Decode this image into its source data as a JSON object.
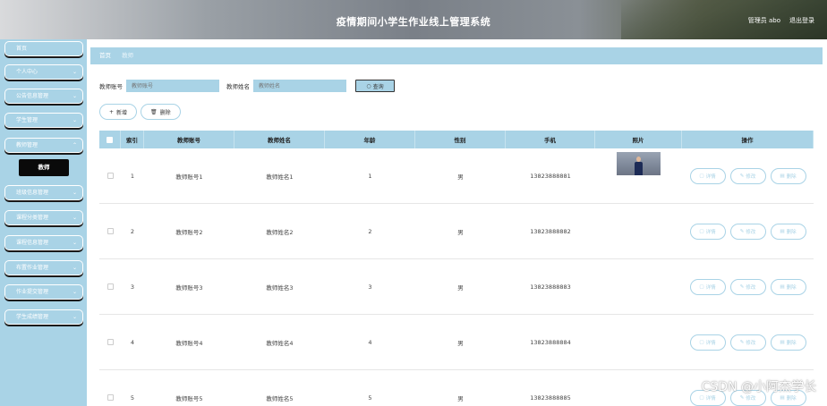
{
  "header": {
    "title": "疫情期间小学生作业线上管理系统",
    "user_label": "管理员 abo",
    "logout_label": "退出登录"
  },
  "sidebar": {
    "items": [
      {
        "label": "首页",
        "has_chevron": false
      },
      {
        "label": "个人中心",
        "has_chevron": true
      },
      {
        "label": "公告信息管理",
        "has_chevron": true
      },
      {
        "label": "学生管理",
        "has_chevron": true
      },
      {
        "label": "教师管理",
        "has_chevron": true
      },
      {
        "label": "班级信息管理",
        "has_chevron": true
      },
      {
        "label": "课程分类管理",
        "has_chevron": true
      },
      {
        "label": "课程信息管理",
        "has_chevron": true
      },
      {
        "label": "布置作业管理",
        "has_chevron": true
      },
      {
        "label": "作业提交管理",
        "has_chevron": true
      },
      {
        "label": "学生成绩管理",
        "has_chevron": true
      }
    ],
    "active_submenu": "教师"
  },
  "breadcrumb": {
    "home": "首页",
    "current": "教师"
  },
  "search": {
    "account_label": "教师账号",
    "account_placeholder": "教师账号",
    "name_label": "教师姓名",
    "name_placeholder": "教师姓名",
    "button_label": "查询"
  },
  "actions": {
    "add_label": "新增",
    "delete_label": "删除"
  },
  "table": {
    "headers": [
      "",
      "索引",
      "教师账号",
      "教师姓名",
      "年龄",
      "性别",
      "手机",
      "照片",
      "操作"
    ],
    "rows": [
      {
        "index": "1",
        "account": "教师账号1",
        "name": "教师姓名1",
        "age": "1",
        "gender": "男",
        "phone": "13823888881",
        "has_photo": true
      },
      {
        "index": "2",
        "account": "教师账号2",
        "name": "教师姓名2",
        "age": "2",
        "gender": "男",
        "phone": "13823888882",
        "has_photo": false
      },
      {
        "index": "3",
        "account": "教师账号3",
        "name": "教师姓名3",
        "age": "3",
        "gender": "男",
        "phone": "13823888883",
        "has_photo": false
      },
      {
        "index": "4",
        "account": "教师账号4",
        "name": "教师姓名4",
        "age": "4",
        "gender": "男",
        "phone": "13823888884",
        "has_photo": false
      },
      {
        "index": "5",
        "account": "教师账号5",
        "name": "教师姓名5",
        "age": "5",
        "gender": "男",
        "phone": "13823888885",
        "has_photo": false
      }
    ],
    "op_labels": {
      "detail": "详情",
      "edit": "修改",
      "delete": "删除"
    }
  },
  "watermark": "CSDN @小阿杰学长",
  "colors": {
    "accent": "#a9d3e6",
    "submenu_bg": "#0a0a0a"
  }
}
